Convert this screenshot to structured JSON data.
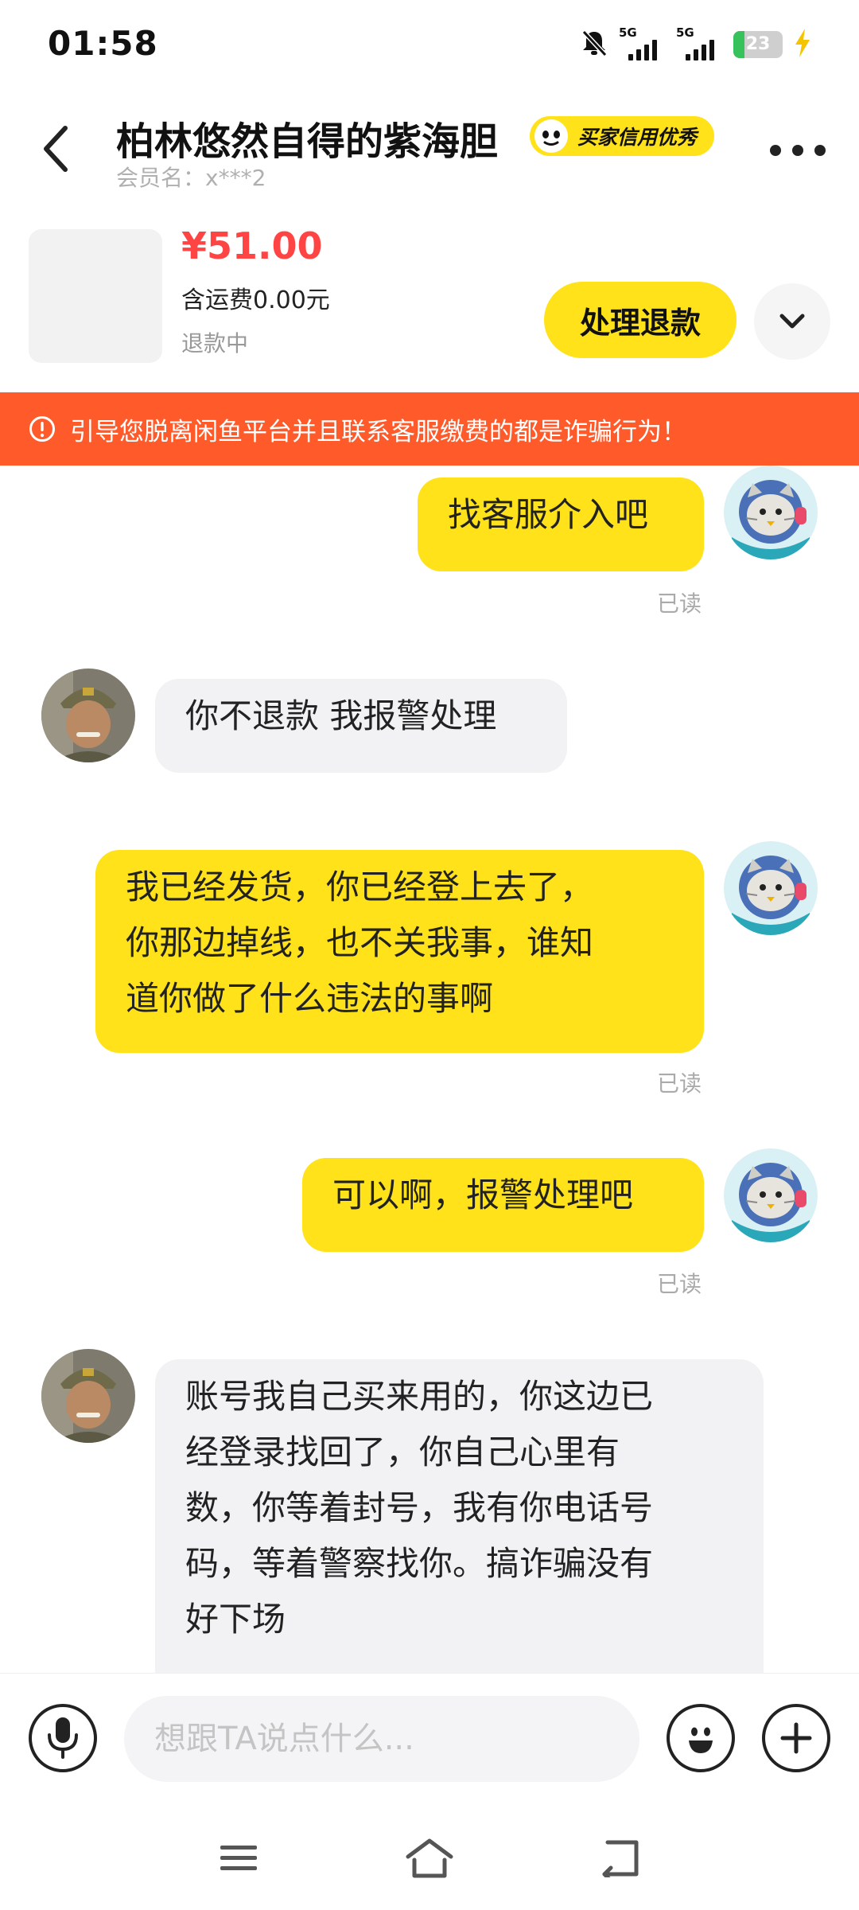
{
  "status_bar": {
    "time": "01:58",
    "network_1": "5G",
    "network_2": "5G",
    "battery": "23",
    "battery_level_percent": 23
  },
  "header": {
    "title": "柏林悠然自得的紫海胆",
    "credit_badge": "买家信用优秀",
    "member_label": "会员名：x***2"
  },
  "product": {
    "price": "¥51.00",
    "shipping": "含运费0.00元",
    "status": "退款中",
    "refund_button": "处理退款"
  },
  "warning": {
    "text": "引导您脱离闲鱼平台并且联系客服缴费的都是诈骗行为！"
  },
  "messages": [
    {
      "sender": "me",
      "lines": [
        "找客服介入吧"
      ],
      "read": "已读"
    },
    {
      "sender": "other",
      "lines": [
        "你不退款 我报警处理"
      ]
    },
    {
      "sender": "me",
      "lines": [
        "我已经发货，你已经登上去了，",
        "你那边掉线，也不关我事，谁知",
        "道你做了什么违法的事啊"
      ],
      "read": "已读"
    },
    {
      "sender": "me",
      "lines": [
        "可以啊，报警处理吧"
      ],
      "read": "已读"
    },
    {
      "sender": "other",
      "lines": [
        "账号我自己买来用的，你这边已",
        "经登录找回了，你自己心里有",
        "数，你等着封号，我有你电话号",
        "码，等着警察找你。搞诈骗没有",
        "好下场"
      ]
    }
  ],
  "input": {
    "placeholder": "想跟TA说点什么..."
  },
  "colors": {
    "accent": "#ffe21a",
    "price": "#ff4444",
    "warning_bg": "#ff5a2a",
    "bubble_theirs": "#f2f2f4"
  },
  "icons": {
    "back": "back-arrow-icon",
    "more": "more-dots-icon",
    "expand": "chevron-down-icon",
    "warning": "exclamation-circle-icon",
    "mic": "microphone-icon",
    "emoji": "smiley-icon",
    "plus": "plus-icon",
    "nav_menu": "menu-icon",
    "nav_home": "home-icon",
    "nav_back": "back-icon"
  }
}
